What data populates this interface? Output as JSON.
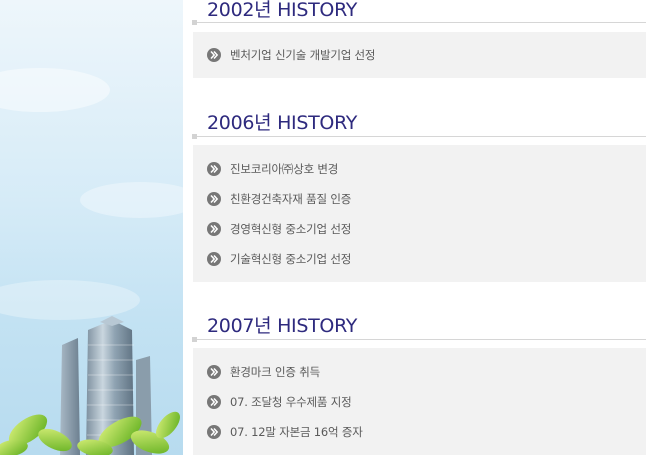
{
  "colors": {
    "title": "#2e2a7e",
    "box_background": "#f2f2f2",
    "item_text": "#5a5a5a",
    "bullet": "#777777",
    "rule": "#d6d6d6"
  },
  "sections": [
    {
      "title": "2002년 HISTORY",
      "items": [
        "벤처기업 신기술 개발기업 선정"
      ]
    },
    {
      "title": "2006년 HISTORY",
      "items": [
        "진보코리아㈜상호 변경",
        "친환경건축자재 품질 인증",
        "경영혁신형 중소기업 선정",
        "기술혁신형 중소기업 선정"
      ]
    },
    {
      "title": "2007년 HISTORY",
      "items": [
        "환경마크 인증 취득",
        "07. 조달청 우수제품 지정",
        "07. 12말 자본금 16억 증자"
      ]
    }
  ],
  "icons": {
    "bullet": "double-chevron-right-icon"
  }
}
